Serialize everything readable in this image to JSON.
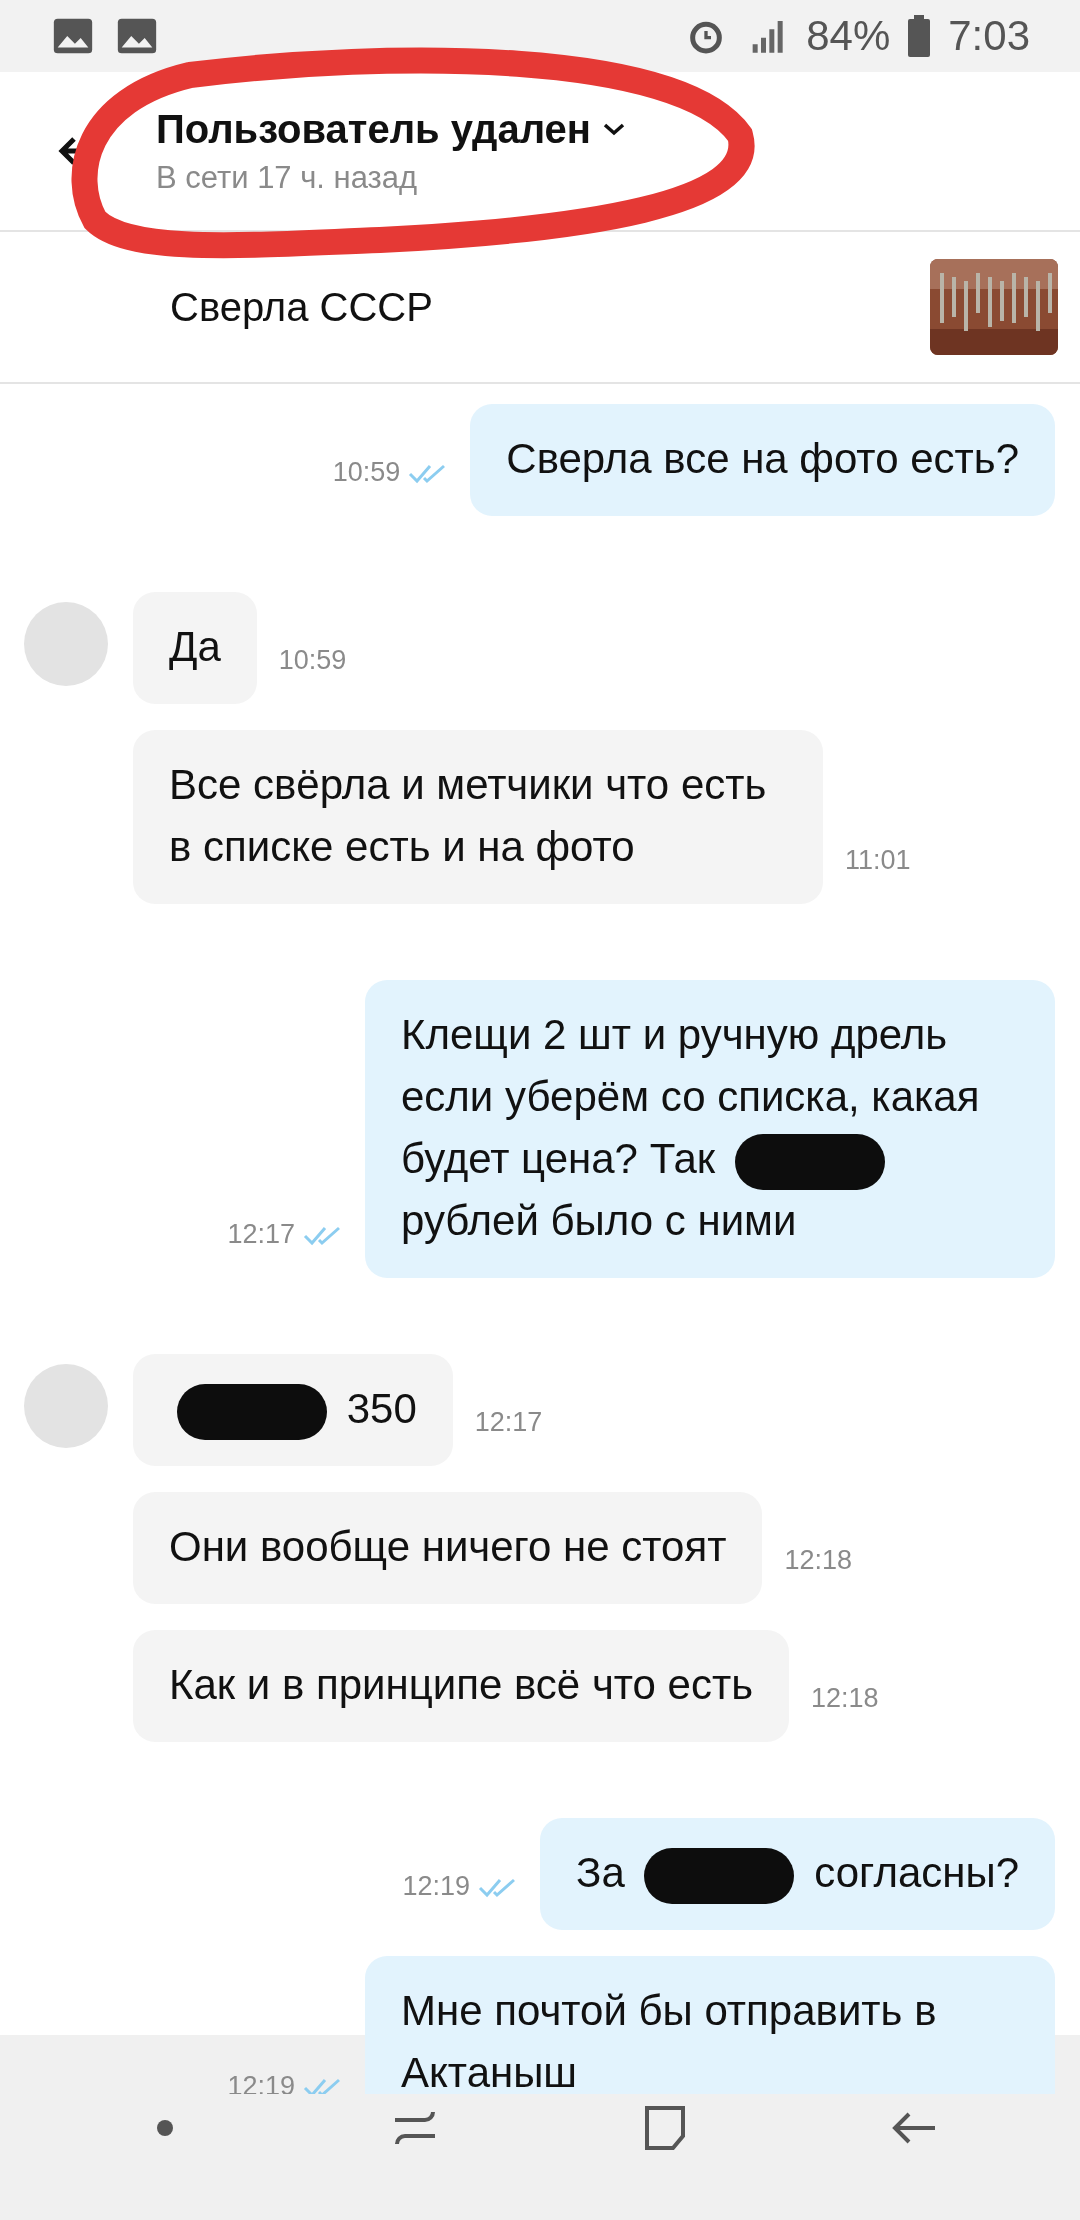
{
  "status_bar": {
    "battery": "84%",
    "time": "7:03"
  },
  "header": {
    "title": "Пользователь удален",
    "subtitle": "В сети 17 ч. назад"
  },
  "listing": {
    "title": "Сверла СССР"
  },
  "messages": [
    {
      "kind": "outgoing",
      "parts": [
        {
          "kind": "text",
          "text": "Сверла все на фото есть?"
        }
      ],
      "time": "10:59",
      "read": true
    },
    {
      "kind": "incoming",
      "parts": [
        {
          "kind": "text",
          "text": "Да"
        }
      ],
      "time": "10:59"
    },
    {
      "kind": "incoming",
      "parts": [
        {
          "kind": "text",
          "text": "Все свёрла и метчики что есть в списке есть и на фото"
        }
      ],
      "time": "11:01"
    },
    {
      "kind": "outgoing",
      "parts": [
        {
          "kind": "text",
          "text": "Клещи 2 шт и ручную дрель если уберём со списка, какая будет цена? Так"
        },
        {
          "kind": "redacted"
        },
        {
          "kind": "text",
          "text": "рублей было с ними"
        }
      ],
      "time": "12:17",
      "read": true
    },
    {
      "kind": "incoming",
      "parts": [
        {
          "kind": "redacted"
        },
        {
          "kind": "text",
          "text": "350"
        }
      ],
      "time": "12:17"
    },
    {
      "kind": "incoming",
      "parts": [
        {
          "kind": "text",
          "text": "Они вообще ничего не стоят"
        }
      ],
      "time": "12:18"
    },
    {
      "kind": "incoming",
      "parts": [
        {
          "kind": "text",
          "text": "Как и в принципе всё что есть"
        }
      ],
      "time": "12:18"
    },
    {
      "kind": "outgoing",
      "parts": [
        {
          "kind": "text",
          "text": "За"
        },
        {
          "kind": "redacted"
        },
        {
          "kind": "text",
          "text": "согласны?"
        }
      ],
      "time": "12:19",
      "read": true
    },
    {
      "kind": "outgoing",
      "parts": [
        {
          "kind": "text",
          "text": "Мне почтой бы отправить в Актаныш"
        }
      ],
      "time": "12:19",
      "read": true
    }
  ]
}
